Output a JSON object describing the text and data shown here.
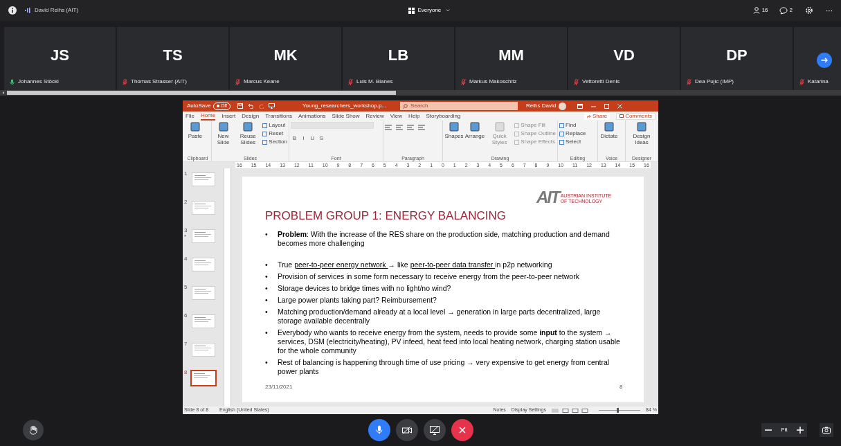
{
  "top_bar": {
    "presenter": "David Reihs (AIT)",
    "audience": "Everyone",
    "participants_count": "16",
    "chat_count": "2",
    "more": "···"
  },
  "participants": [
    {
      "initials": "JS",
      "name": "Johannes Stöckl",
      "muted": false
    },
    {
      "initials": "TS",
      "name": "Thomas Strasser (AIT)",
      "muted": true
    },
    {
      "initials": "MK",
      "name": "Marcus Keane",
      "muted": true
    },
    {
      "initials": "LB",
      "name": "Luis M. Blanes",
      "muted": true
    },
    {
      "initials": "MM",
      "name": "Markus Makoschitz",
      "muted": true
    },
    {
      "initials": "VD",
      "name": "Vettoretti Denis",
      "muted": true
    },
    {
      "initials": "DP",
      "name": "Dea Pujic (IMP)",
      "muted": true
    },
    {
      "name": "Katarina",
      "muted": true
    }
  ],
  "powerpoint": {
    "title_bar": {
      "autosave": "AutoSave",
      "autosave_state": "Off",
      "autosave_on": false,
      "file_name": "Young_researchers_workshop.p...",
      "search": "Search",
      "user": "Reihs David"
    },
    "tabs": [
      {
        "label": "File",
        "selected": false
      },
      {
        "label": "Home",
        "selected": true
      },
      {
        "label": "Insert",
        "selected": false
      },
      {
        "label": "Design",
        "selected": false
      },
      {
        "label": "Transitions",
        "selected": false
      },
      {
        "label": "Animations",
        "selected": false
      },
      {
        "label": "Slide Show",
        "selected": false
      },
      {
        "label": "Review",
        "selected": false
      },
      {
        "label": "View",
        "selected": false
      },
      {
        "label": "Help",
        "selected": false
      },
      {
        "label": "Storyboarding",
        "selected": false
      }
    ],
    "share": "Share",
    "comments": "Comments",
    "ribbon_groups": [
      {
        "label": "Clipboard",
        "items": [
          {
            "kind": "large",
            "label": "Paste",
            "disabled": false
          }
        ]
      },
      {
        "label": "Slides",
        "items": [
          {
            "kind": "large",
            "label": "New Slide",
            "disabled": false
          },
          {
            "kind": "large",
            "label": "Reuse Slides",
            "disabled": false
          },
          {
            "kind": "small",
            "label": "Layout",
            "disabled": false
          },
          {
            "kind": "small",
            "label": "Reset",
            "disabled": false
          },
          {
            "kind": "small",
            "label": "Section",
            "disabled": false
          }
        ]
      },
      {
        "label": "Font",
        "items": [
          {
            "kind": "format",
            "label": "B",
            "disabled": false
          },
          {
            "kind": "format",
            "label": "I",
            "disabled": false
          },
          {
            "kind": "format",
            "label": "U",
            "disabled": false
          },
          {
            "kind": "format",
            "label": "S",
            "disabled": false
          }
        ]
      },
      {
        "label": "Paragraph",
        "items": [
          {
            "kind": "align",
            "disabled": false
          },
          {
            "kind": "align",
            "disabled": false
          },
          {
            "kind": "align",
            "disabled": false
          },
          {
            "kind": "align",
            "disabled": false
          }
        ]
      },
      {
        "label": "Drawing",
        "items": [
          {
            "kind": "large",
            "label": "Shapes",
            "disabled": false
          },
          {
            "kind": "large",
            "label": "Arrange",
            "disabled": false
          },
          {
            "kind": "large",
            "label": "Quick Styles",
            "disabled": true
          },
          {
            "kind": "small",
            "label": "Shape Fill",
            "disabled": true
          },
          {
            "kind": "small",
            "label": "Shape Outline",
            "disabled": true
          },
          {
            "kind": "small",
            "label": "Shape Effects",
            "disabled": true
          }
        ]
      },
      {
        "label": "Editing",
        "items": [
          {
            "kind": "small",
            "label": "Find",
            "disabled": false
          },
          {
            "kind": "small",
            "label": "Replace",
            "disabled": false
          },
          {
            "kind": "small",
            "label": "Select",
            "disabled": false
          }
        ]
      },
      {
        "label": "Voice",
        "items": [
          {
            "kind": "large",
            "label": "Dictate",
            "disabled": false
          }
        ]
      },
      {
        "label": "Designer",
        "items": [
          {
            "kind": "large",
            "label": "Design Ideas",
            "disabled": false
          }
        ]
      }
    ],
    "ruler_labels": [
      "16",
      "15",
      "14",
      "13",
      "12",
      "11",
      "10",
      "9",
      "8",
      "7",
      "6",
      "5",
      "4",
      "3",
      "2",
      "1",
      "0",
      "1",
      "2",
      "3",
      "4",
      "5",
      "6",
      "7",
      "8",
      "9",
      "10",
      "11",
      "12",
      "13",
      "14",
      "15",
      "16"
    ],
    "thumbnails": [
      {
        "number": "1",
        "selected": false
      },
      {
        "number": "2",
        "selected": false
      },
      {
        "number": "3",
        "selected": false,
        "animation_mark": "*"
      },
      {
        "number": "4",
        "selected": false
      },
      {
        "number": "5",
        "selected": false
      },
      {
        "number": "6",
        "selected": false
      },
      {
        "number": "7",
        "selected": false
      },
      {
        "number": "8",
        "selected": true
      }
    ],
    "slide": {
      "bullet_marker": "•",
      "logo": "AIT",
      "logo_caption": "AUSTRIAN INSTITUTE OF TECHNOLOGY",
      "title": "PROBLEM GROUP 1: ENERGY BALANCING",
      "bullets": [
        {
          "segments": [
            {
              "text": "**Problem**: With the increase of the RES share on the production side, matching production and demand becomes more challenging",
              "underline": false
            }
          ]
        },
        {
          "segments": [
            {
              "text": "True ",
              "underline": false
            },
            {
              "text": "peer-to-peer energy network ",
              "underline": true
            },
            {
              "text": "→ like ",
              "underline": false
            },
            {
              "text": "peer-to-peer data transfer ",
              "underline": true
            },
            {
              "text": "in p2p networking",
              "underline": false
            }
          ]
        },
        {
          "segments": [
            {
              "text": "Provision of services in some form necessary to receive energy from the peer-to-peer network",
              "underline": false
            }
          ]
        },
        {
          "segments": [
            {
              "text": "Storage devices to bridge times with no light/no wind?",
              "underline": false
            }
          ]
        },
        {
          "segments": [
            {
              "text": "Large power plants taking part? Reimbursement?",
              "underline": false
            }
          ]
        },
        {
          "segments": [
            {
              "text": "Matching production/demand already at a local level → generation in large parts decentralized, large storage available decentrally",
              "underline": false
            }
          ]
        },
        {
          "segments": [
            {
              "text": "Everybody who wants to receive energy from the system, needs to provide some **input** to the system → services, DSM (electricity/heating), PV infeed, heat feed into local heating network, charging station usable for the whole community",
              "underline": false
            }
          ]
        },
        {
          "segments": [
            {
              "text": "Rest of balancing is happening through time of use pricing → very expensive to get energy from central power plants",
              "underline": false
            }
          ]
        }
      ],
      "date": "23/11/2021",
      "page": "8"
    },
    "status_bar": {
      "slide": "Slide 8 of 8",
      "language": "English (United States)",
      "notes": "Notes",
      "display": "Display Settings",
      "zoom": "84 %"
    }
  },
  "controls": {
    "mic_on": true,
    "camera_on": false,
    "sharing_on": false,
    "zoom_fit": "Fit"
  }
}
